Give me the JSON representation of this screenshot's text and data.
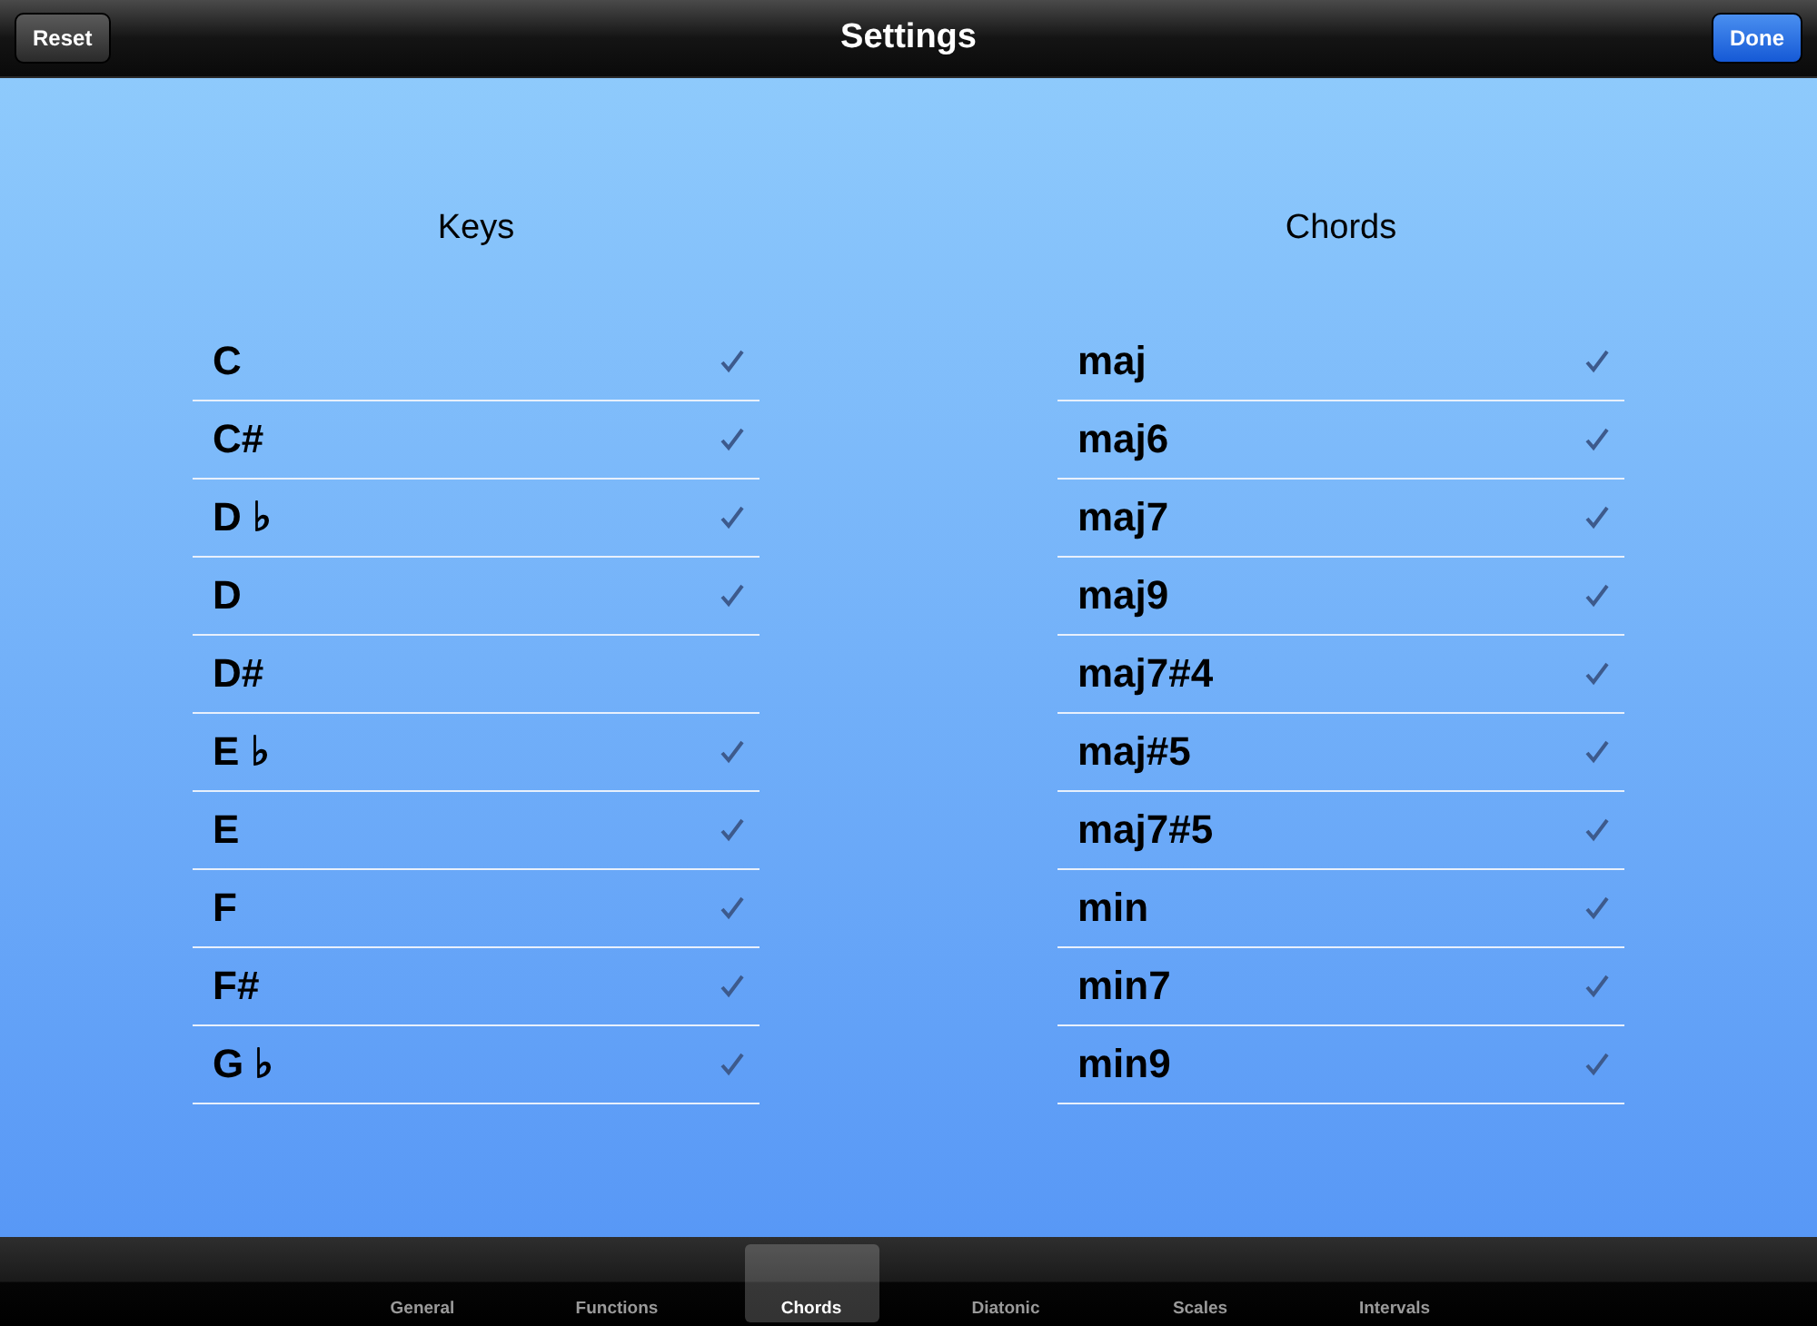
{
  "nav_bar": {
    "title": "Settings",
    "left_button": "Reset",
    "right_button": "Done"
  },
  "keys": {
    "heading": "Keys",
    "items": [
      {
        "label": "C",
        "checked": true
      },
      {
        "label": "C#",
        "checked": true
      },
      {
        "label": "D ♭",
        "checked": true
      },
      {
        "label": "D",
        "checked": true
      },
      {
        "label": "D#",
        "checked": false
      },
      {
        "label": "E ♭",
        "checked": true
      },
      {
        "label": "E",
        "checked": true
      },
      {
        "label": "F",
        "checked": true
      },
      {
        "label": "F#",
        "checked": true
      },
      {
        "label": "G ♭",
        "checked": true
      }
    ]
  },
  "chords": {
    "heading": "Chords",
    "items": [
      {
        "label": "maj",
        "checked": true
      },
      {
        "label": "maj6",
        "checked": true
      },
      {
        "label": "maj7",
        "checked": true
      },
      {
        "label": "maj9",
        "checked": true
      },
      {
        "label": "maj7#4",
        "checked": true
      },
      {
        "label": "maj#5",
        "checked": true
      },
      {
        "label": "maj7#5",
        "checked": true
      },
      {
        "label": "min",
        "checked": true
      },
      {
        "label": "min7",
        "checked": true
      },
      {
        "label": "min9",
        "checked": true
      }
    ]
  },
  "tabs": [
    {
      "label": "General",
      "selected": false
    },
    {
      "label": "Functions",
      "selected": false
    },
    {
      "label": "Chords",
      "selected": true
    },
    {
      "label": "Diatonic",
      "selected": false
    },
    {
      "label": "Scales",
      "selected": false
    },
    {
      "label": "Intervals",
      "selected": false
    }
  ]
}
